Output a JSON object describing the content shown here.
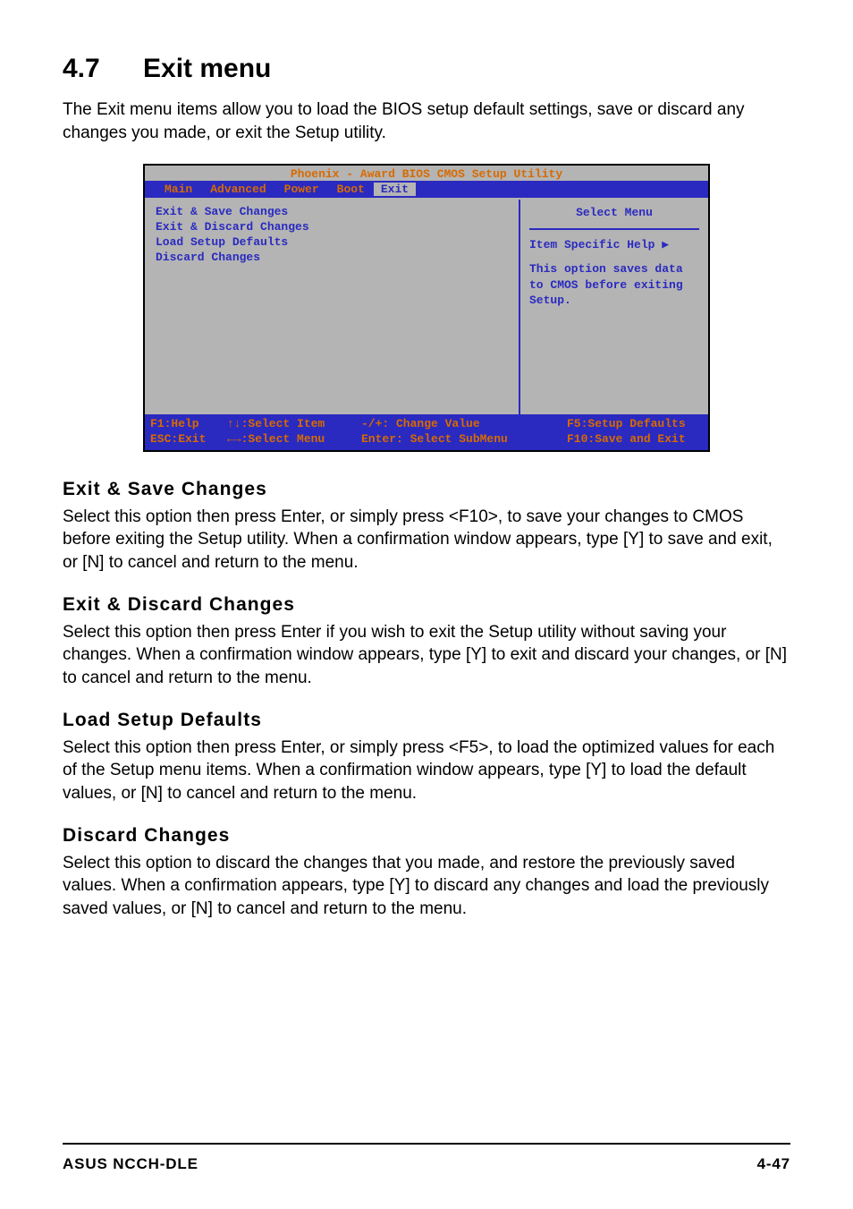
{
  "title": {
    "num": "4.7",
    "text": "Exit menu"
  },
  "intro": "The Exit menu items allow you to load the BIOS setup default settings, save or discard any changes you made, or exit the Setup utility.",
  "bios": {
    "title": "Phoenix - Award BIOS CMOS Setup Utility",
    "tabs": [
      "Main",
      "Advanced",
      "Power",
      "Boot",
      "Exit"
    ],
    "active_tab_index": 4,
    "left_items": [
      "Exit & Save Changes",
      "Exit & Discard Changes",
      "Load Setup Defaults",
      "Discard Changes"
    ],
    "right": {
      "select_menu": "Select Menu",
      "help_label": "Item Specific Help",
      "help_body": "This option saves data to CMOS before exiting Setup."
    },
    "footer": {
      "r1c1": "F1:Help",
      "r1c2": "↑↓:Select Item",
      "r1c3": "-/+: Change Value",
      "r1c4": "F5:Setup Defaults",
      "r2c1": "ESC:Exit",
      "r2c2": "←→:Select Menu",
      "r2c3": "Enter: Select SubMenu",
      "r2c4": "F10:Save and Exit"
    }
  },
  "sections": [
    {
      "heading": "Exit & Save Changes",
      "body": "Select this option then press Enter, or simply press <F10>, to save your changes to CMOS before exiting the Setup utility. When a confirmation window appears, type [Y] to save and exit, or [N] to cancel and return to the menu."
    },
    {
      "heading": "Exit & Discard Changes",
      "body": "Select this option then press Enter if you wish to exit the Setup utility without saving your changes. When a confirmation window appears, type [Y] to exit and discard your changes, or [N] to cancel and return to the menu."
    },
    {
      "heading": "Load Setup Defaults",
      "body": "Select this option then press Enter, or simply press <F5>, to load the optimized values for each of the Setup menu items. When a confirmation window appears, type [Y] to load the default values, or [N] to cancel and return to the menu."
    },
    {
      "heading": "Discard Changes",
      "body": "Select this option to discard the changes that you made, and restore the previously saved values. When a confirmation appears, type [Y] to discard any changes and load the previously saved values, or [N] to cancel and return to the menu."
    }
  ],
  "footer": {
    "left": "ASUS NCCH-DLE",
    "right": "4-47"
  }
}
